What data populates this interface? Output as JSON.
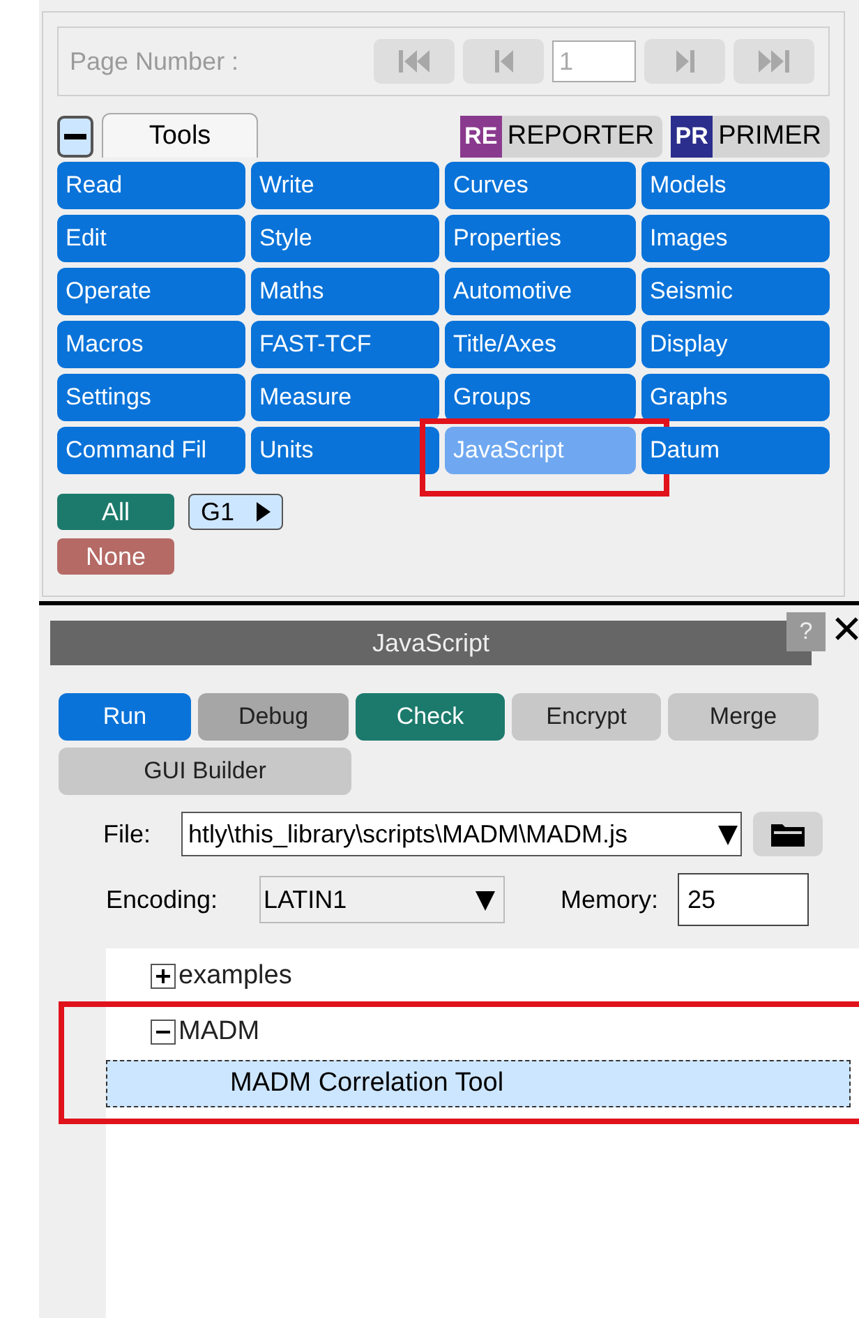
{
  "page_bar": {
    "label": "Page Number :",
    "value": "1",
    "disabled": true
  },
  "tabs": [
    {
      "label": "Tools",
      "selected": true
    }
  ],
  "apps": [
    {
      "badge": "RE",
      "label": "REPORTER",
      "color": "#8a3a8e"
    },
    {
      "badge": "PR",
      "label": "PRIMER",
      "color": "#2b2e8c"
    }
  ],
  "tools": [
    {
      "label": "Read",
      "selected": false
    },
    {
      "label": "Write",
      "selected": false
    },
    {
      "label": "Curves",
      "selected": false
    },
    {
      "label": "Models",
      "selected": false
    },
    {
      "label": "Edit",
      "selected": false
    },
    {
      "label": "Style",
      "selected": false
    },
    {
      "label": "Properties",
      "selected": false
    },
    {
      "label": "Images",
      "selected": false
    },
    {
      "label": "Operate",
      "selected": false
    },
    {
      "label": "Maths",
      "selected": false
    },
    {
      "label": "Automotive",
      "selected": false
    },
    {
      "label": "Seismic",
      "selected": false
    },
    {
      "label": "Macros",
      "selected": false
    },
    {
      "label": "FAST-TCF",
      "selected": false
    },
    {
      "label": "Title/Axes",
      "selected": false
    },
    {
      "label": "Display",
      "selected": false
    },
    {
      "label": "Settings",
      "selected": false
    },
    {
      "label": "Measure",
      "selected": false
    },
    {
      "label": "Groups",
      "selected": false
    },
    {
      "label": "Graphs",
      "selected": false
    },
    {
      "label": "Command Fil",
      "selected": false
    },
    {
      "label": "Units",
      "selected": false
    },
    {
      "label": "JavaScript",
      "selected": true,
      "highlighted": true
    },
    {
      "label": "Datum",
      "selected": false
    }
  ],
  "select_buttons": [
    {
      "label": "All",
      "kind": "all"
    },
    {
      "label": "G1",
      "kind": "group"
    },
    {
      "label": "None",
      "kind": "none"
    }
  ],
  "panel": {
    "title": "JavaScript",
    "help": "?",
    "close": "✕"
  },
  "actions": [
    {
      "label": "Run",
      "kind": "primary"
    },
    {
      "label": "Debug",
      "kind": "dark"
    },
    {
      "label": "Check",
      "kind": "teal"
    },
    {
      "label": "Encrypt",
      "kind": "plain"
    },
    {
      "label": "Merge",
      "kind": "plain"
    },
    {
      "label": "GUI Builder",
      "kind": "plain"
    }
  ],
  "file": {
    "label": "File:",
    "value": "htly\\this_library\\scripts\\MADM\\MADM.js"
  },
  "encoding": {
    "label": "Encoding:",
    "value": "LATIN1"
  },
  "memory": {
    "label": "Memory:",
    "value": "25"
  },
  "tree": [
    {
      "label": "examples",
      "expanded": false,
      "selected": false,
      "highlighted": false
    },
    {
      "label": "MADM",
      "expanded": true,
      "selected": false,
      "highlighted": true,
      "children": [
        {
          "label": "MADM Correlation Tool",
          "selected": true
        }
      ]
    }
  ]
}
